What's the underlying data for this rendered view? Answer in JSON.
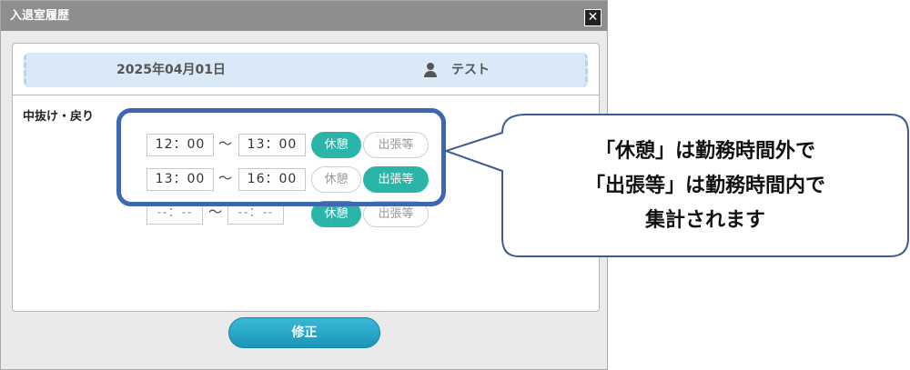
{
  "dialog": {
    "title": "入退室履歴",
    "close_symbol": "✕"
  },
  "header": {
    "date": "2025年04月01日",
    "user_name": "テスト",
    "user_icon": "person-icon"
  },
  "section_label": "中抜け・戻り",
  "tilde": "〜",
  "rows": [
    {
      "start": "12：00",
      "end": "13：00",
      "break_label": "休憩",
      "business_label": "出張等",
      "selected": "break"
    },
    {
      "start": "13：00",
      "end": "16：00",
      "break_label": "休憩",
      "business_label": "出張等",
      "selected": "business"
    },
    {
      "start": "--：--",
      "end": "--：--",
      "break_label": "休憩",
      "business_label": "出張等",
      "selected": "break"
    }
  ],
  "fix_button": "修正",
  "callout": {
    "line1": "「休憩」は勤務時間外で",
    "line2": "「出張等」は勤務時間内で",
    "line3": "集計されます"
  },
  "colors": {
    "titlebar": "#8e8e8e",
    "accent_teal": "#2bb5a8",
    "highlight_border": "#3b67b3",
    "button_blue": "#1a96b8"
  }
}
